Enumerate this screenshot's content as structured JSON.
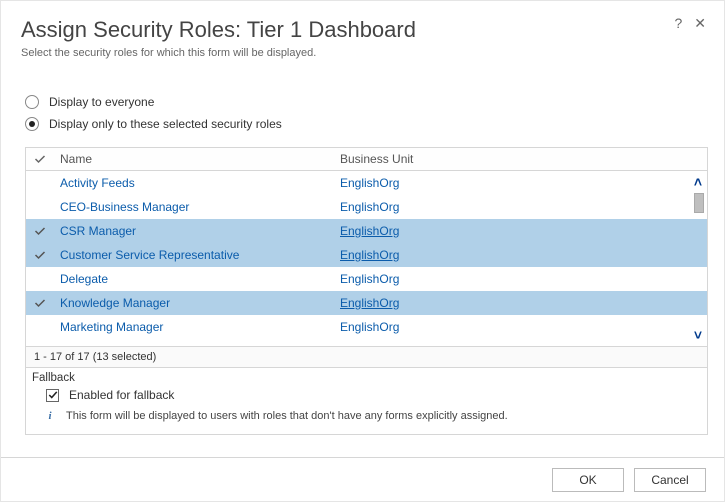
{
  "header": {
    "title": "Assign Security Roles: Tier 1 Dashboard",
    "subtitle": "Select the security roles for which this form will be displayed."
  },
  "options": {
    "everyone_label": "Display to everyone",
    "selected_label": "Display only to these selected security roles",
    "selected_value": "selected"
  },
  "table": {
    "columns": {
      "name": "Name",
      "bu": "Business Unit"
    },
    "rows": [
      {
        "name": "Activity Feeds",
        "bu": "EnglishOrg",
        "selected": false
      },
      {
        "name": "CEO-Business Manager",
        "bu": "EnglishOrg",
        "selected": false
      },
      {
        "name": "CSR Manager",
        "bu": "EnglishOrg",
        "selected": true
      },
      {
        "name": "Customer Service Representative",
        "bu": "EnglishOrg",
        "selected": true
      },
      {
        "name": "Delegate",
        "bu": "EnglishOrg",
        "selected": false
      },
      {
        "name": "Knowledge Manager",
        "bu": "EnglishOrg",
        "selected": true
      },
      {
        "name": "Marketing Manager",
        "bu": "EnglishOrg",
        "selected": false
      }
    ],
    "status": "1 - 17 of 17 (13 selected)"
  },
  "fallback": {
    "section_label": "Fallback",
    "checkbox_label": "Enabled for fallback",
    "checked": true,
    "note": "This form will be displayed to users with roles that don't have any forms explicitly assigned."
  },
  "footer": {
    "ok": "OK",
    "cancel": "Cancel"
  },
  "icons": {
    "help": "?",
    "close": "✕"
  }
}
